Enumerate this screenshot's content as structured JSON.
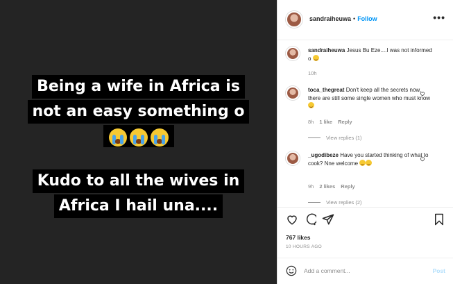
{
  "post": {
    "caption_lines": [
      "Being a wife in Africa is",
      "not an easy something o"
    ],
    "emoji": "😭😭😭",
    "caption_lines_2": [
      "Kudo to all the wives in",
      "Africa I hail una...."
    ]
  },
  "header": {
    "username": "sandraiheuwa",
    "separator": "•",
    "follow_label": "Follow",
    "more_icon": "•••"
  },
  "comments": [
    {
      "username": "sandraiheuwa",
      "text": "Jesus Bu Eze....I was not informed o",
      "emoji": "😂",
      "time": "10h"
    },
    {
      "username": "toca_thegreat",
      "text": "Don't keep all the secrets now, there are still some single women who must know",
      "emoji": "😂",
      "time": "8h",
      "likes": "1 like",
      "reply": "Reply",
      "view_replies": "View replies (1)"
    },
    {
      "username": "_ugodibeze",
      "text": "Have you started thinking of what to cook? Nne welcome",
      "emoji": "😂😂",
      "time": "9h",
      "likes": "2 likes",
      "reply": "Reply",
      "view_replies": "View replies (2)"
    }
  ],
  "actions": {
    "likes": "767 likes",
    "time_ago": "10 HOURS AGO",
    "icons": [
      "heart-icon",
      "comment-icon",
      "share-icon",
      "bookmark-icon"
    ]
  },
  "add_comment": {
    "placeholder": "Add a comment...",
    "post_label": "Post"
  },
  "colors": {
    "image_bg": "#242424",
    "link_blue": "#0095f6",
    "muted": "#8e8e8e"
  }
}
